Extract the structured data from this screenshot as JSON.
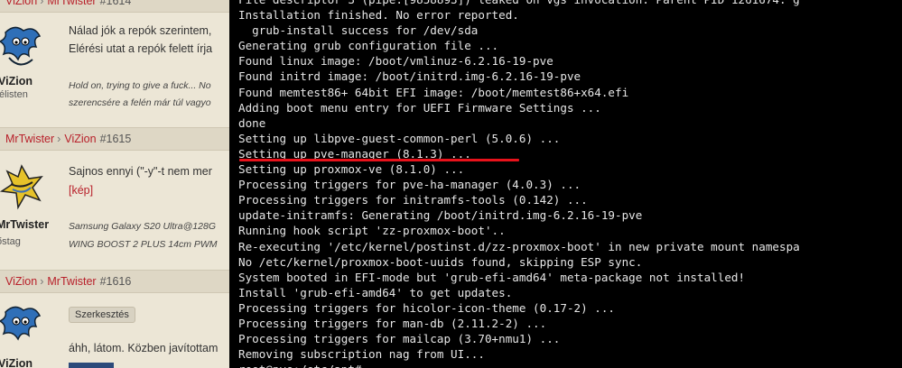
{
  "forum": {
    "posts": [
      {
        "header": {
          "from": "ViZion",
          "to": "MrTwister",
          "number": "#1614"
        },
        "author": {
          "name": "ViZion",
          "rank": "félisten"
        },
        "lines": [
          "Nálad jók a repók szerintem,",
          "Elérési utat a repók felett írja"
        ],
        "signature": [
          "Hold on, trying to give a fuck... No",
          "szerencsére a felén már túl vagyo"
        ]
      },
      {
        "header": {
          "from": "MrTwister",
          "to": "ViZion",
          "number": "#1615"
        },
        "author": {
          "name": "MrTwister",
          "rank": "őstag"
        },
        "lines": [
          "Sajnos ennyi (\"-y\"-t nem mer"
        ],
        "link": "[kép]",
        "signature": [
          "Samsung Galaxy S20 Ultra@128G",
          "WING BOOST 2 PLUS 14cm PWM"
        ]
      },
      {
        "header": {
          "from": "ViZion",
          "to": "MrTwister",
          "number": "#1616"
        },
        "author": {
          "name": "ViZion"
        },
        "edit_button": "Szerkesztés",
        "lines": [
          "áhh, látom. Közben javítottam"
        ]
      }
    ]
  },
  "terminal": {
    "lines": [
      "File descriptor 3 (pipe:[9858893]) leaked on vgs invocation. Parent PID 1261674: g",
      "Installation finished. No error reported.",
      "  grub-install success for /dev/sda",
      "Generating grub configuration file ...",
      "Found linux image: /boot/vmlinuz-6.2.16-19-pve",
      "Found initrd image: /boot/initrd.img-6.2.16-19-pve",
      "Found memtest86+ 64bit EFI image: /boot/memtest86+x64.efi",
      "Adding boot menu entry for UEFI Firmware Settings ...",
      "done",
      "Setting up libpve-guest-common-perl (5.0.6) ...",
      "Setting up pve-manager (8.1.3) ...",
      "Setting up proxmox-ve (8.1.0) ...",
      "Processing triggers for pve-ha-manager (4.0.3) ...",
      "Processing triggers for initramfs-tools (0.142) ...",
      "update-initramfs: Generating /boot/initrd.img-6.2.16-19-pve",
      "Running hook script 'zz-proxmox-boot'..",
      "Re-executing '/etc/kernel/postinst.d/zz-proxmox-boot' in new private mount namespa",
      "No /etc/kernel/proxmox-boot-uuids found, skipping ESP sync.",
      "System booted in EFI-mode but 'grub-efi-amd64' meta-package not installed!",
      "Install 'grub-efi-amd64' to get updates.",
      "Processing triggers for hicolor-icon-theme (0.17-2) ...",
      "Processing triggers for man-db (2.11.2-2) ...",
      "Processing triggers for mailcap (3.70+nmu1) ...",
      "Removing subscription nag from UI...",
      "root@pve:/etc/apt#"
    ],
    "highlight_color": "#e8121b"
  }
}
